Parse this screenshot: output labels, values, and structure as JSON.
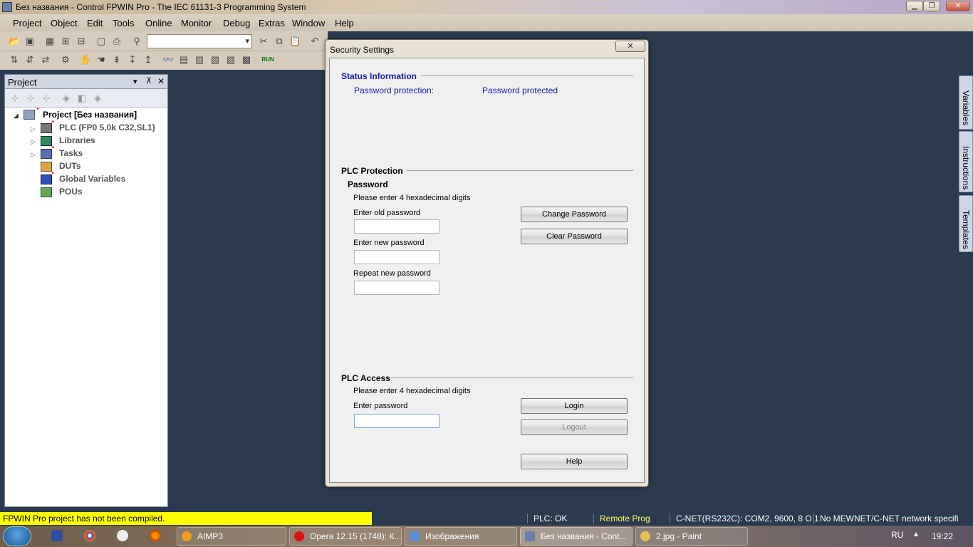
{
  "window": {
    "title": "Без названия - Control FPWIN Pro - The IEC 61131-3 Programming System"
  },
  "menu": [
    "Project",
    "Object",
    "Edit",
    "Tools",
    "Online",
    "Monitor",
    "Debug",
    "Extras",
    "Window",
    "Help"
  ],
  "toolbar2_run": "RUN",
  "project_panel": {
    "title": "Project",
    "pin": "▾ ⊼ ✕",
    "tree": [
      {
        "label": "Project [Без названия]",
        "modified": true
      },
      {
        "label": "PLC (FP0 5,0k C32,SL1)",
        "modified": true
      },
      {
        "label": "Libraries",
        "modified": false
      },
      {
        "label": "Tasks",
        "modified": true
      },
      {
        "label": "DUTs",
        "modified": false
      },
      {
        "label": "Global Variables",
        "modified": true
      },
      {
        "label": "POUs",
        "modified": false
      }
    ]
  },
  "sidetabs": [
    "Variables",
    "Instructions",
    "Templates"
  ],
  "dialog": {
    "title": "Security Settings",
    "close": "✕",
    "status": {
      "heading": "Status Information",
      "key": "Password protection:",
      "value": "Password protected"
    },
    "protection": {
      "heading": "PLC Protection",
      "subheading": "Password",
      "hint": "Please enter 4 hexadecimal digits",
      "old_label": "Enter old password",
      "new_label": "Enter new password",
      "repeat_label": "Repeat new password",
      "change_btn": "Change Password",
      "clear_btn": "Clear Password"
    },
    "access": {
      "heading": "PLC Access",
      "hint": "Please enter 4 hexadecimal digits",
      "pw_label": "Enter password",
      "login_btn": "Login",
      "logout_btn": "Logout",
      "help_btn": "Help"
    }
  },
  "statusbar": {
    "warning": "FPWIN Pro project has not been compiled.",
    "plc": "PLC: OK",
    "mode": "Remote Prog",
    "port": "C-NET(RS232C): COM2, 9600, 8 O 1",
    "network": "No MEWNET/C-NET network specifi"
  },
  "taskbar": {
    "items": [
      "AIMP3",
      "Opera 12.15 (1748): К...",
      "Изображения",
      "Без названия - Cont...",
      "2.jpg - Paint"
    ],
    "lang": "RU",
    "clock": "19:22"
  },
  "colors": {
    "status_blue": "#1a1ab0",
    "warn_yellow": "#ffff00",
    "mode_yellow": "#ffff66"
  }
}
